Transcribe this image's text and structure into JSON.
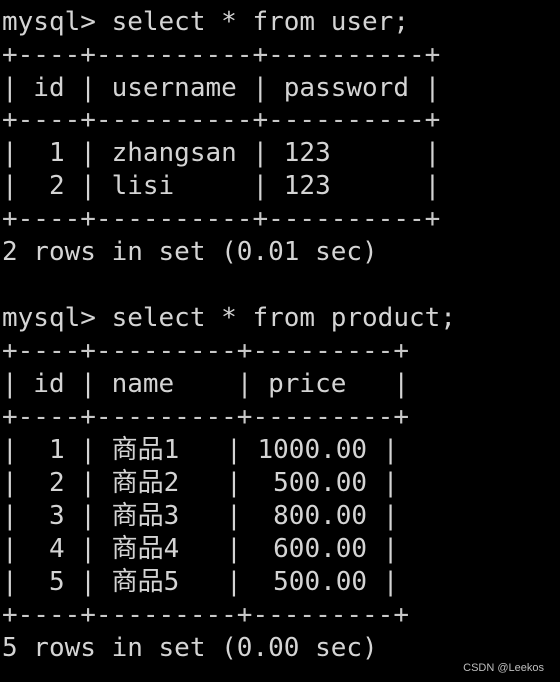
{
  "window": {
    "background": "#000000",
    "text_color": "#d4d4d4"
  },
  "terminal": {
    "lines": [
      "mysql> select * from user;",
      "+----+----------+----------+",
      "| id | username | password |",
      "+----+----------+----------+",
      "|  1 | zhangsan | 123      |",
      "|  2 | lisi     | 123      |",
      "+----+----------+----------+",
      "2 rows in set (0.01 sec)",
      "",
      "mysql> select * from product;",
      "+----+---------+---------+",
      "| id | name    | price   |",
      "+----+---------+---------+",
      "|  1 | 商品1   | 1000.00 |",
      "|  2 | 商品2   |  500.00 |",
      "|  3 | 商品3   |  800.00 |",
      "|  4 | 商品4   |  600.00 |",
      "|  5 | 商品5   |  500.00 |",
      "+----+---------+---------+",
      "5 rows in set (0.00 sec)"
    ]
  },
  "watermark": {
    "text": "CSDN @Leekos"
  }
}
